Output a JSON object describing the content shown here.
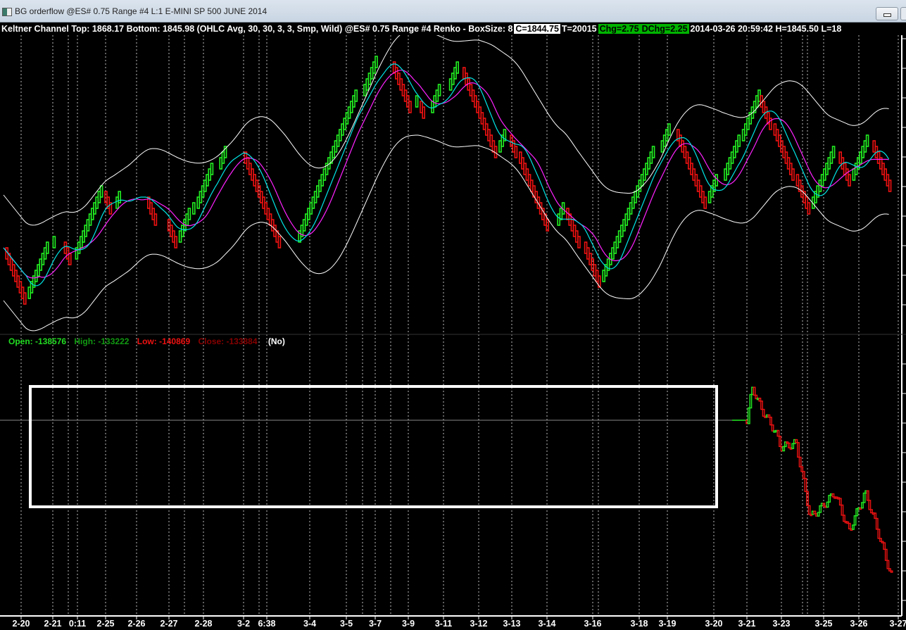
{
  "window": {
    "title": "BG orderflow  @ES#  0.75 Range  #4  L:1  E-MINI SP 500 JUNE 2014",
    "icon": "app-icon"
  },
  "header": {
    "study": "Keltner Channel  Top: 1868.17  Bottom: 1845.98  (OHLC Avg, 30, 30, 3, 3, Smp, Wild)  @ES#  0.75 Range  #4 Renko - BoxSize: 8",
    "close": "C=1844.75",
    "ticks": "T=20015",
    "chg": "Chg=2.75",
    "dchg": "DChg=2.25",
    "datetime": "2014-03-26 20:59:42 H=1845.50 L=18"
  },
  "lower_panel": {
    "open": "Open: -138576",
    "high": "High: -133222",
    "low": "Low: -140869",
    "close": "Close: -133884",
    "flag": "(No)"
  },
  "x_axis": {
    "labels": [
      "2-20",
      "2-21",
      "0:11",
      "2-25",
      "2-26",
      "2-27",
      "2-28",
      "3-2",
      "6:38",
      "3-4",
      "3-5",
      "3-7",
      "3-9",
      "3-11",
      "3-12",
      "3-13",
      "3-14",
      "3-16",
      "3-18",
      "3-19",
      "3-20",
      "3-21",
      "3-23",
      "3-25",
      "3-26",
      "3-27"
    ]
  },
  "colors": {
    "up": "#22ee22",
    "down": "#ee1111",
    "ma_fast": "#00e5e5",
    "ma_slow": "#ff22ff",
    "bands": "#ffffff",
    "info_open": "#22dd22",
    "info_high": "#119911",
    "info_low": "#ee1111",
    "info_close": "#880000"
  }
}
